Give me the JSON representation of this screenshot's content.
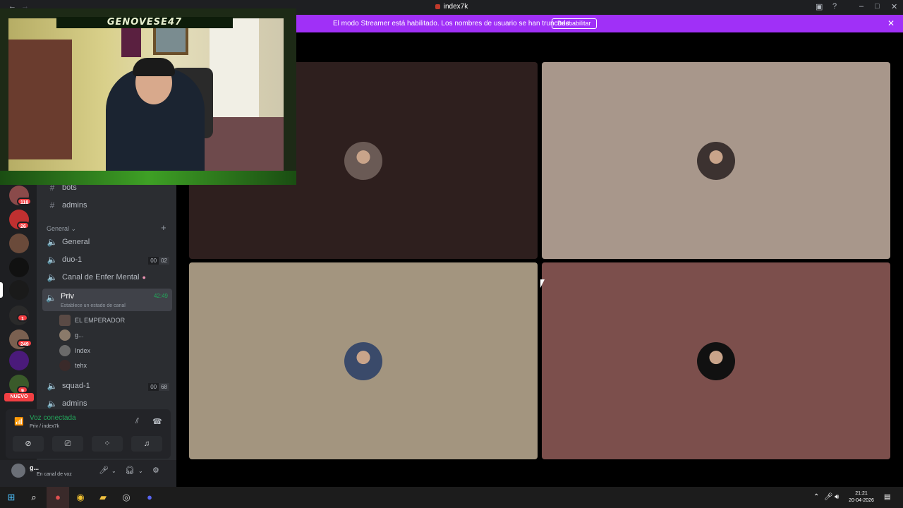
{
  "window": {
    "title": "index7k"
  },
  "banner": {
    "message": "El modo Streamer está habilitado. Los nombres de usuario se han truncado.",
    "button": "Deshabilitar"
  },
  "webcam": {
    "name": "GENOVESE47"
  },
  "servers": {
    "badges": [
      "118",
      "26",
      "1",
      "249",
      "9"
    ],
    "new_label": "NUEVO"
  },
  "channels": {
    "text": [
      {
        "label": "bots"
      },
      {
        "label": "admins"
      }
    ],
    "category": "General",
    "voice": [
      {
        "label": "General"
      },
      {
        "label": "duo-1",
        "count_a": "00",
        "count_b": "02"
      },
      {
        "label": "Canal de Enfer Mental"
      }
    ],
    "active": {
      "label": "Priv",
      "time": "42:49",
      "status": "Establece un estado de canal"
    },
    "members": [
      {
        "name": "EL EMPERADOR"
      },
      {
        "name": "g..."
      },
      {
        "name": "Index"
      },
      {
        "name": "tehx"
      }
    ],
    "after": [
      {
        "label": "squad-1",
        "count_a": "00",
        "count_b": "68"
      },
      {
        "label": "admins"
      }
    ]
  },
  "voice_status": {
    "title": "Voz conectada",
    "subtitle": "Priv / index7k"
  },
  "user": {
    "name": "g...",
    "status": "En canal de voz"
  },
  "tiles": [
    {
      "color": "#2e1f1e",
      "avatar": "#6a5a55"
    },
    {
      "color": "#a8978b",
      "avatar": "#3c3230"
    },
    {
      "color": "#a3957f",
      "avatar": "#3a4a6a"
    },
    {
      "color": "#7c4f4c",
      "avatar": "#111111"
    }
  ],
  "taskbar": {
    "time": "21:21",
    "date": "20-04-2026"
  }
}
